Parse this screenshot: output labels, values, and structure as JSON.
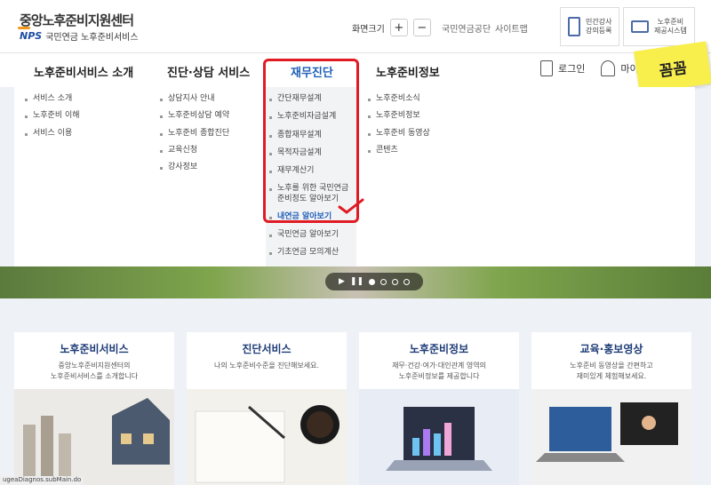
{
  "header": {
    "logo_main": "중앙노후준비지원센터",
    "logo_nps": "NPS",
    "logo_sub": "국민연금 노후준비서비스",
    "fontsize_label": "화면크기",
    "plus": "+",
    "minus": "−",
    "link_nps": "국민연금공단",
    "link_sitemap": "사이트맵",
    "quick1": "민간강사\n강의등록",
    "quick2": "노후준비\n제공시스템"
  },
  "sticker": "꼼꼼",
  "nav": {
    "items": [
      "노후준비서비스 소개",
      "진단·상담 서비스",
      "재무진단",
      "노후준비정보"
    ],
    "login": "로그인",
    "mypage": "마이"
  },
  "menu": {
    "col1": [
      "서비스 소개",
      "노후준비 이해",
      "서비스 이용"
    ],
    "col2": [
      "상담지사 안내",
      "노후준비상담 예약",
      "노후준비 종합진단",
      "교육신청",
      "강사정보"
    ],
    "col3": [
      "간단재무설계",
      "노후준비자금설계",
      "종합재무설계",
      "목적자금설계",
      "재무계산기",
      "노후를 위한 국민연금\n준비정도 알아보기",
      "내연금 알아보기",
      "국민연금 알아보기",
      "기초연금 모의계산"
    ],
    "col4": [
      "노후준비소식",
      "노후준비정보",
      "노후준비 동영상",
      "콘텐츠"
    ]
  },
  "banner": {
    "pause": "❚❚"
  },
  "cards": [
    {
      "title": "노후준비서비스",
      "desc": "중앙노후준비지원센터의\n노후준비서비스를 소개합니다"
    },
    {
      "title": "진단서비스",
      "desc": "나의 노후준비수준을 진단해보세요."
    },
    {
      "title": "노후준비정보",
      "desc": "재무·건강·여가·대인관계 영역의\n노후준비정보를 제공합니다"
    },
    {
      "title": "교육·홍보영상",
      "desc": "노후준비 동영상을 간편하고\n재미있게 체험해보세요."
    }
  ],
  "status_text": "ugeaDiagnos.subMain.do",
  "colors": {
    "accent": "#1f5fb8",
    "highlight": "#e01b24",
    "sticker": "#f9ef4c"
  }
}
